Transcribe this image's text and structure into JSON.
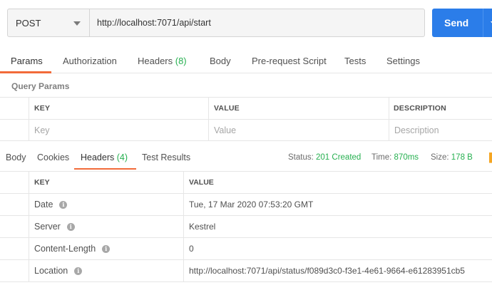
{
  "request": {
    "method": "POST",
    "url": "http://localhost:7071/api/start",
    "send_label": "Send"
  },
  "request_tabs": [
    {
      "label": "Params",
      "count": ""
    },
    {
      "label": "Authorization",
      "count": ""
    },
    {
      "label": "Headers ",
      "count": "(8)"
    },
    {
      "label": "Body",
      "count": ""
    },
    {
      "label": "Pre-request Script",
      "count": ""
    },
    {
      "label": "Tests",
      "count": ""
    },
    {
      "label": "Settings",
      "count": ""
    }
  ],
  "query_params": {
    "title": "Query Params",
    "columns": [
      "KEY",
      "VALUE",
      "DESCRIPTION"
    ],
    "placeholders": [
      "Key",
      "Value",
      "Description"
    ]
  },
  "response_tabs": [
    {
      "label": "Body",
      "count": ""
    },
    {
      "label": "Cookies",
      "count": ""
    },
    {
      "label": "Headers ",
      "count": "(4)"
    },
    {
      "label": "Test Results",
      "count": ""
    }
  ],
  "response_status": {
    "status_label": "Status:",
    "status_value": "201 Created",
    "time_label": "Time:",
    "time_value": "870ms",
    "size_label": "Size:",
    "size_value": "178 B"
  },
  "response_headers": {
    "columns": [
      "KEY",
      "VALUE"
    ],
    "rows": [
      {
        "key": "Date",
        "value": "Tue, 17 Mar 2020 07:53:20 GMT"
      },
      {
        "key": "Server",
        "value": "Kestrel"
      },
      {
        "key": "Content-Length",
        "value": "0"
      },
      {
        "key": "Location",
        "value": "http://localhost:7071/api/status/f089d3c0-f3e1-4e61-9664-e61283951cb5"
      }
    ]
  },
  "colors": {
    "accent": "#f26b3a",
    "send_button": "#2b7de9",
    "success": "#26b050"
  }
}
